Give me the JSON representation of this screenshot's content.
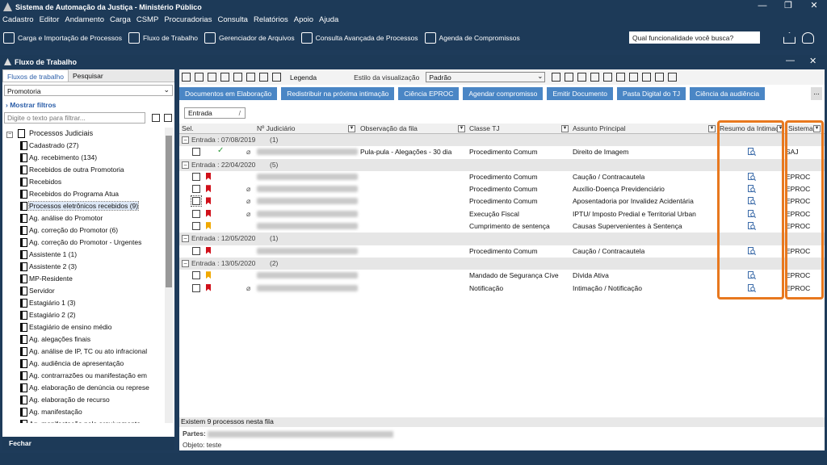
{
  "window": {
    "title": "Sistema de Automação da Justiça - Ministério Público"
  },
  "menu": [
    "Cadastro",
    "Editor",
    "Andamento",
    "Carga",
    "CSMP",
    "Procuradorias",
    "Consulta",
    "Relatórios",
    "Apoio",
    "Ajuda"
  ],
  "toolbar": {
    "items": [
      "Carga e Importação de Processos",
      "Fluxo de Trabalho",
      "Gerenciador de Arquivos",
      "Consulta Avançada de Processos",
      "Agenda de Compromissos"
    ],
    "search_value": "Qual funcionalidade você busca?"
  },
  "panel": {
    "title": "Fluxo de Trabalho"
  },
  "left": {
    "tabs": [
      "Fluxos de trabalho",
      "Pesquisar"
    ],
    "combo": "Promotoria",
    "show_filters": "Mostrar filtros",
    "filter_placeholder": "Digite o texto para filtrar...",
    "root": "Processos Judiciais",
    "items": [
      "Cadastrado (27)",
      "Ag. recebimento (134)",
      "Recebidos de outra Promotoria",
      "Recebidos",
      "Recebidos do Programa Atua",
      "Processos eletrônicos recebidos (9)",
      "Ag. análise do Promotor",
      "Ag. correção do Promotor (6)",
      "Ag. correção do Promotor - Urgentes",
      "Assistente 1 (1)",
      "Assistente 2 (3)",
      "MP-Residente",
      "Servidor",
      "Estagiário 1 (3)",
      "Estagiário 2 (2)",
      "Estagiário de ensino médio",
      "Ag. alegações finais",
      "Ag. análise de IP, TC ou ato infracional",
      "Ag. audiência de apresentação",
      "Ag. contrarrazões ou manifestação em",
      "Ag. elaboração de denúncia ou represe",
      "Ag. elaboração de recurso",
      "Ag. manifestação",
      "Ag. manifestação pelo arquivamento"
    ],
    "close_label": "Fechar"
  },
  "right": {
    "legend_label": "Legenda",
    "view_style_label": "Estilo da visualização",
    "view_style_value": "Padrão",
    "actions": [
      "Documentos em Elaboração",
      "Redistribuir na próxima intimação",
      "Ciência EPROC",
      "Agendar compromisso",
      "Emitir Documento",
      "Pasta Digital do TJ",
      "Ciência da audiência"
    ],
    "more_label": "...",
    "group_chip": "Entrada",
    "columns": [
      "Sel.",
      "Nº Judiciário",
      "Observação da fila",
      "Classe TJ",
      "Assunto Principal",
      "Resumo da Intimaç...",
      "Sistema"
    ],
    "groups": [
      {
        "label": "Entrada : 07/08/2019",
        "count": "(1)",
        "rows": [
          {
            "flag": "",
            "check": "✓",
            "clip": true,
            "obs": "Pula-pula - Alegações - 30 dia",
            "classe": "Procedimento Comum",
            "assunto": "Direito de Imagem",
            "sistema": "SAJ"
          }
        ]
      },
      {
        "label": "Entrada : 22/04/2020",
        "count": "(5)",
        "rows": [
          {
            "flag": "#d0101a",
            "check": "",
            "clip": false,
            "obs": "",
            "classe": "Procedimento Comum",
            "assunto": "Caução / Contracautela",
            "sistema": "EPROC"
          },
          {
            "flag": "#d0101a",
            "check": "",
            "clip": true,
            "obs": "",
            "classe": "Procedimento Comum",
            "assunto": "Auxílio-Doença Previdenciário",
            "sistema": "EPROC"
          },
          {
            "flag": "#d0101a",
            "check": "",
            "clip": true,
            "obs": "",
            "classe": "Procedimento Comum",
            "assunto": "Aposentadoria por Invalidez Acidentária",
            "sistema": "EPROC"
          },
          {
            "flag": "#d0101a",
            "check": "",
            "clip": true,
            "obs": "",
            "classe": "Execução Fiscal",
            "assunto": "IPTU/ Imposto Predial e Territorial Urban",
            "sistema": "EPROC"
          },
          {
            "flag": "#f0a800",
            "check": "",
            "clip": false,
            "obs": "",
            "classe": "Cumprimento de sentença",
            "assunto": "Causas Supervenientes à Sentença",
            "sistema": "EPROC"
          }
        ]
      },
      {
        "label": "Entrada : 12/05/2020",
        "count": "(1)",
        "rows": [
          {
            "flag": "#d0101a",
            "check": "",
            "clip": false,
            "obs": "",
            "classe": "Procedimento Comum",
            "assunto": "Caução / Contracautela",
            "sistema": "EPROC"
          }
        ]
      },
      {
        "label": "Entrada : 13/05/2020",
        "count": "(2)",
        "rows": [
          {
            "flag": "#f0a800",
            "check": "",
            "clip": false,
            "obs": "",
            "classe": "Mandado de Segurança Cíve",
            "assunto": "Dívida Ativa",
            "sistema": "EPROC"
          },
          {
            "flag": "#d0101a",
            "check": "",
            "clip": true,
            "obs": "",
            "classe": "Notificação",
            "assunto": "Intimação / Notificação",
            "sistema": "EPROC"
          }
        ]
      }
    ],
    "status": "Existem 9 processos nesta fila",
    "parts_label": "Partes:",
    "object_label": "Objeto: teste"
  },
  "colors": {
    "chrome": "#1d3a58",
    "action": "#4a86c5",
    "highlight": "#e8781e",
    "flag_red": "#d0101a",
    "flag_yellow": "#f0a800"
  }
}
